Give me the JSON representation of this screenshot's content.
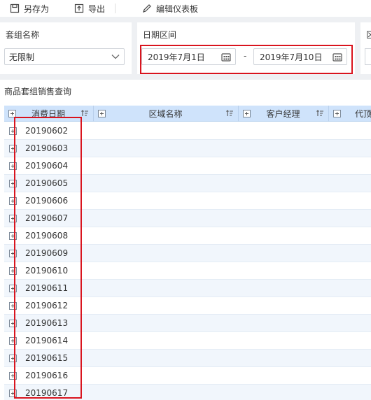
{
  "toolbar": {
    "save_as": "另存为",
    "export": "导出",
    "edit_dashboard": "编辑仪表板"
  },
  "filters": {
    "group_name": {
      "label": "套组名称",
      "value": "无限制"
    },
    "date_range": {
      "label": "日期区间",
      "start": "2019年7月1日",
      "end": "2019年7月10日",
      "separator": "-"
    },
    "region": {
      "label": "区"
    }
  },
  "report": {
    "title": "商品套组销售查询",
    "columns": [
      "消费日期",
      "区域名称",
      "客户经理",
      "代顶"
    ],
    "rows": [
      "20190602",
      "20190603",
      "20190604",
      "20190605",
      "20190606",
      "20190607",
      "20190608",
      "20190609",
      "20190610",
      "20190611",
      "20190612",
      "20190613",
      "20190614",
      "20190615",
      "20190616",
      "20190617"
    ]
  },
  "colors": {
    "highlight": "#d9141e",
    "header_bg": "#cfe3fb"
  }
}
